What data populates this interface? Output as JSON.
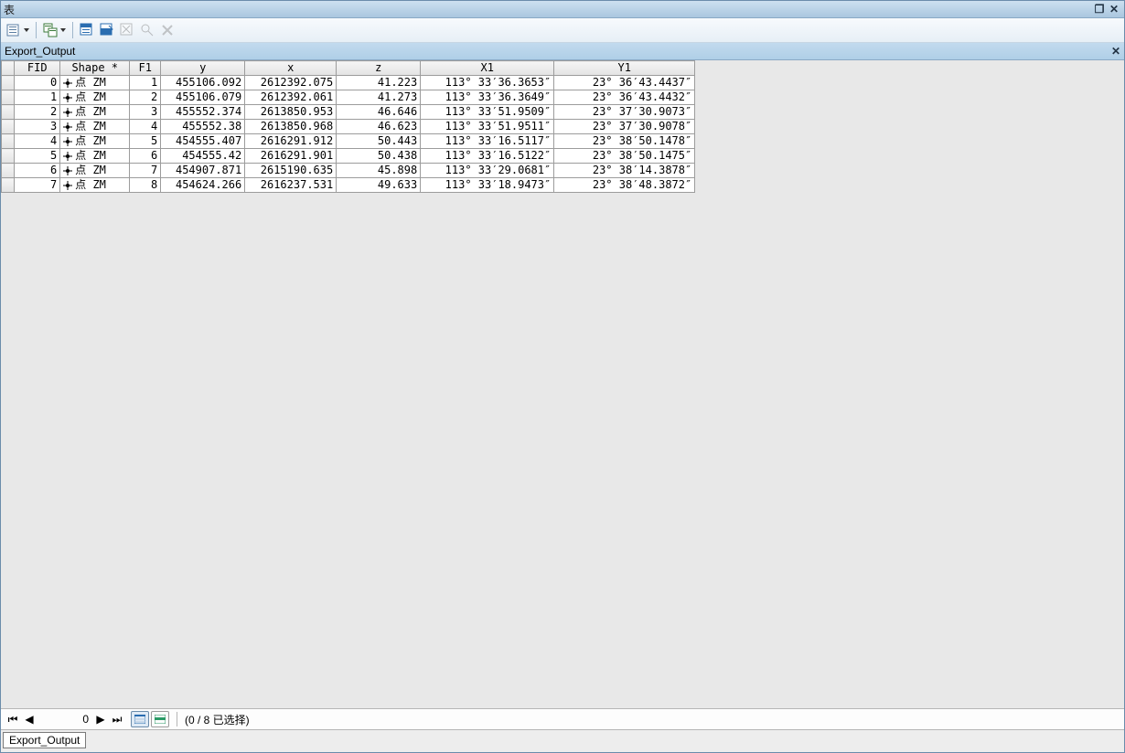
{
  "window": {
    "title": "表"
  },
  "panel": {
    "title": "Export_Output"
  },
  "table": {
    "headers": {
      "fid": "FID",
      "shape": "Shape *",
      "f1": "F1",
      "y": "y",
      "x": "x",
      "z": "z",
      "x1": "X1",
      "y1": "Y1"
    },
    "shape_label": "点 ZM",
    "rows": [
      {
        "fid": "0",
        "f1": "1",
        "y": "455106.092",
        "x": "2612392.075",
        "z": "41.223",
        "x1": "113° 33′36.3653″",
        "y1": "23° 36′43.4437″"
      },
      {
        "fid": "1",
        "f1": "2",
        "y": "455106.079",
        "x": "2612392.061",
        "z": "41.273",
        "x1": "113° 33′36.3649″",
        "y1": "23° 36′43.4432″"
      },
      {
        "fid": "2",
        "f1": "3",
        "y": "455552.374",
        "x": "2613850.953",
        "z": "46.646",
        "x1": "113° 33′51.9509″",
        "y1": "23° 37′30.9073″"
      },
      {
        "fid": "3",
        "f1": "4",
        "y": "455552.38",
        "x": "2613850.968",
        "z": "46.623",
        "x1": "113° 33′51.9511″",
        "y1": "23° 37′30.9078″"
      },
      {
        "fid": "4",
        "f1": "5",
        "y": "454555.407",
        "x": "2616291.912",
        "z": "50.443",
        "x1": "113° 33′16.5117″",
        "y1": "23° 38′50.1478″"
      },
      {
        "fid": "5",
        "f1": "6",
        "y": "454555.42",
        "x": "2616291.901",
        "z": "50.438",
        "x1": "113° 33′16.5122″",
        "y1": "23° 38′50.1475″"
      },
      {
        "fid": "6",
        "f1": "7",
        "y": "454907.871",
        "x": "2615190.635",
        "z": "45.898",
        "x1": "113° 33′29.0681″",
        "y1": "23° 38′14.3878″"
      },
      {
        "fid": "7",
        "f1": "8",
        "y": "454624.266",
        "x": "2616237.531",
        "z": "49.633",
        "x1": "113° 33′18.9473″",
        "y1": "23° 38′48.3872″"
      }
    ]
  },
  "nav": {
    "record": "0",
    "status": "(0 / 8 已选择)"
  },
  "tab": {
    "label": "Export_Output"
  }
}
